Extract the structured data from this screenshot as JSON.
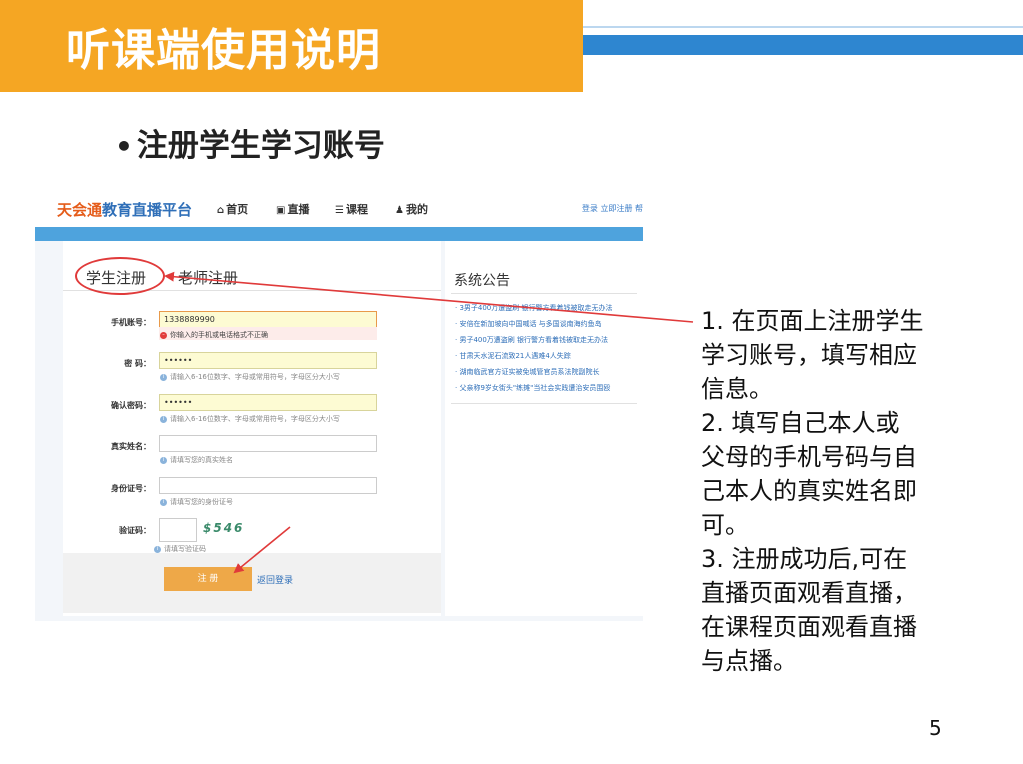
{
  "slide": {
    "title": "听课端使用说明",
    "bullet": "注册学生学习账号",
    "page_number": "5",
    "annotation_lines": [
      "1. 在页面上注册学生",
      "学习账号，填写相应",
      "信息。",
      "2. 填写自己本人或",
      "父母的手机号码与自",
      "己本人的真实姓名即",
      "可。",
      "3. 注册成功后,可在",
      "直播页面观看直播，",
      "在课程页面观看直播",
      "与点播。"
    ]
  },
  "site": {
    "brand_a": "天会通",
    "brand_b": "教育直播平台",
    "nav": [
      {
        "icon": "home-icon",
        "glyph": "⌂",
        "label": "首页"
      },
      {
        "icon": "live-icon",
        "glyph": "▣",
        "label": "直播"
      },
      {
        "icon": "list-icon",
        "glyph": "☰",
        "label": "课程"
      },
      {
        "icon": "user-icon",
        "glyph": "♟",
        "label": "我的"
      }
    ],
    "nav_right": "登录  立即注册  帮"
  },
  "register": {
    "tab_student": "学生注册",
    "tab_teacher": "老师注册",
    "fields": {
      "phone": {
        "label": "手机账号：",
        "value": "1338889990",
        "error": "你输入的手机或电话格式不正确"
      },
      "password": {
        "label": "密 码：",
        "value": "••••••",
        "hint": "请输入6-16位数字、字母或常用符号，字母区分大小写"
      },
      "confirm": {
        "label": "确认密码：",
        "value": "••••••",
        "hint": "请输入6-16位数字、字母或常用符号，字母区分大小写"
      },
      "realname": {
        "label": "真实姓名：",
        "value": "",
        "hint": "请填写您的真实姓名"
      },
      "idcard": {
        "label": "身份证号：",
        "value": "",
        "hint": "请填写您的身份证号"
      },
      "captcha": {
        "label": "验证码：",
        "value": "",
        "image_text": "$546",
        "hint": "请填写验证码"
      }
    },
    "submit_label": "注 册",
    "back_login": "返回登录"
  },
  "notice": {
    "title": "系统公告",
    "items": [
      "· 3男子400万遭盗刷 银行警方看着钱被取走无办法",
      "· 安倍在新加坡向中国喊话 与多国谈南海约鱼岛",
      "· 男子400万遭盗刷 银行警方看着钱被取走无办法",
      "· 甘肃天水泥石流致21人遇难4人失踪",
      "· 湖南临武官方证实被免城管官员系法院副院长",
      "· 父亲称9岁女街头\"练摊\"当社会实践遭治安员围殴"
    ]
  },
  "colors": {
    "header_orange": "#f5a623",
    "header_blue": "#2e86d0",
    "annotation_red": "#e03a3a",
    "submit_orange": "#eea848"
  }
}
